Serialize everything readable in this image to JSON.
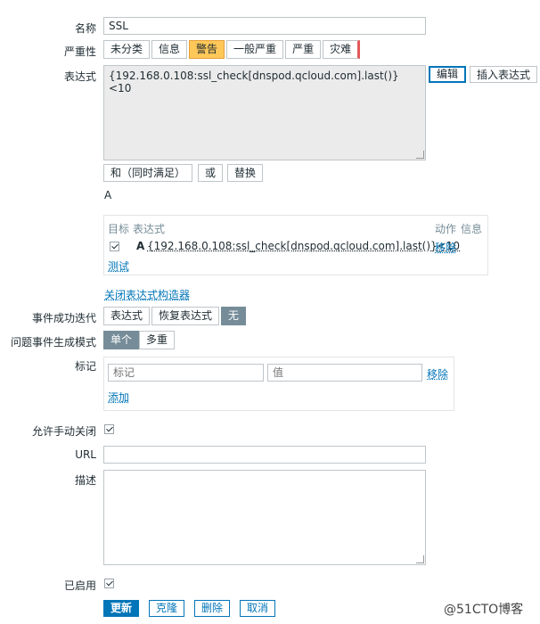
{
  "form": {
    "name_label": "名称",
    "name_value": "SSL",
    "severity_label": "严重性",
    "severity_options": [
      "未分类",
      "信息",
      "警告",
      "一般严重",
      "严重",
      "灾难"
    ],
    "severity_selected": "警告",
    "expression_label": "表达式",
    "expression_value": "{192.168.0.108:ssl_check[dnspod.qcloud.com].last()}<10",
    "edit_button": "编辑",
    "insert_expression_button": "插入表达式",
    "and_button": "和（同时满足）",
    "or_button": "或",
    "replace_button": "替换",
    "expression_letter": "A",
    "builder": {
      "col_target": "目标",
      "col_expression": "表达式",
      "col_action": "动作",
      "col_info": "信息",
      "row_letter": "A",
      "row_expression": "{192.168.0.108:ssl_check[dnspod.qcloud.com].last()}<10",
      "row_action": "移除",
      "test_link": "测试"
    },
    "close_builder_link": "关闭表达式构造器",
    "ok_event_label": "事件成功迭代",
    "ok_event_options": [
      "表达式",
      "恢复表达式",
      "无"
    ],
    "ok_event_selected": "无",
    "problem_mode_label": "问题事件生成模式",
    "problem_mode_options": [
      "单个",
      "多重"
    ],
    "problem_mode_selected": "单个",
    "tags_label": "标记",
    "tag_placeholder": "标记",
    "value_placeholder": "值",
    "tag_remove": "移除",
    "tag_add": "添加",
    "manual_close_label": "允许手动关闭",
    "url_label": "URL",
    "url_value": "",
    "description_label": "描述",
    "description_value": "",
    "enabled_label": "已启用",
    "update_button": "更新",
    "clone_button": "克隆",
    "delete_button": "删除",
    "cancel_button": "取消"
  },
  "watermark": "@51CTO博客",
  "colors": {
    "accent": "#0275b8",
    "warning": "#ffc859",
    "disaster": "#e45959",
    "selected_dark": "#768d99"
  }
}
